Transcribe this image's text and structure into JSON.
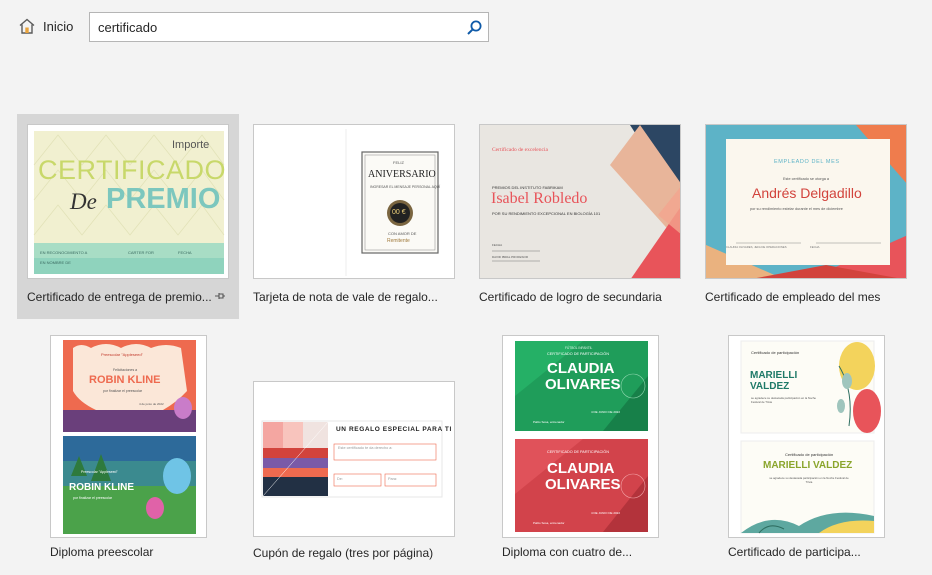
{
  "header": {
    "home_label": "Inicio",
    "search_value": "certificado",
    "home_icon": "home-icon",
    "search_icon": "search-icon"
  },
  "templates": [
    {
      "title": "Certificado de entrega de premio...",
      "pinned": true,
      "thumb": {
        "corner": "Importe",
        "line1": "CERTIFICADO",
        "de": "De",
        "line2": "PREMIO",
        "footer": "EN RECONOCIMIENTO A",
        "footer2": "CARTER FOR",
        "footer3": "FECHA",
        "footer4": "EN NOMBRE DE"
      }
    },
    {
      "title": "Tarjeta de nota de vale de regalo...",
      "thumb": {
        "small": "FELIZ",
        "heading": "ANIVERSARIO",
        "sub": "INGRESAR EL MENSAJE PERSONAL AQUÍ",
        "amount": "00 €",
        "from_label": "CON AMOR DE",
        "from": "Remitente"
      }
    },
    {
      "title": "Certificado de logro de secundaria",
      "thumb": {
        "kicker": "Certificado de excelencia",
        "prize": "PREMIOS DEL INSTITUTO FABRIKAM",
        "name": "Isabel Robledo",
        "reason": "POR SU RENDIMIENTO EXCEPCIONAL EN BIOLOGÍA 101",
        "sig1": "FECHA",
        "sig2": "DAVID IBRAL PROFESOR"
      }
    },
    {
      "title": "Certificado de empleado del mes",
      "thumb": {
        "kicker": "EMPLEADO DEL MES",
        "pre": "Este certificado se otorga a",
        "name": "Andrés Delgadillo",
        "reason": "por su rendimiento estelar durante el mes de diciembre",
        "sig1": "CLAUDIA OLIVARES, JEFA DE OPERACIONES",
        "sig2": "FECHA"
      }
    },
    {
      "title": "Diploma preescolar",
      "thumb": {
        "kicker": "Preescolar \"Appleseed\"",
        "congrats": "Felicitaciones a",
        "name": "ROBIN KLINE",
        "reason": "por finalizar el preescolar",
        "date": "4 de junio de 2022"
      }
    },
    {
      "title": "Cupón de regalo (tres por página)",
      "thumb": {
        "heading": "UN REGALO ESPECIAL PARA TI",
        "field1": "Este certificado te da derecho a:",
        "field2": "De:",
        "field3": "Para:"
      }
    },
    {
      "title": "Diploma con cuatro de...",
      "thumb": {
        "kicker": "FÚTBOL INFANTIL",
        "sub": "CERTIFICADO DE PARTICIPACIÓN",
        "name1": "CLAUDIA",
        "name2": "OLIVARES",
        "date": "4 DE JUNIO DE 2022",
        "coach": "Pablo Sosa, entrenador"
      }
    },
    {
      "title": "Certificado de participa...",
      "thumb": {
        "kicker": "Certificado de participación",
        "name1": "MARIELLI",
        "name2": "VALDEZ",
        "name_full": "MARIELLI VALDEZ",
        "reason": "se agradece su destacada participación en la Noche Festival de Trivia"
      }
    }
  ],
  "colors": {
    "selected_bg": "#d6d6d6",
    "accent": "#0f5aa8",
    "premio_green": "#7cc7be",
    "excelencia_red": "#e8545a",
    "empleado_red": "#d2433c",
    "claudia_green": "#1f9d5a",
    "claudia_red": "#d2434b"
  }
}
